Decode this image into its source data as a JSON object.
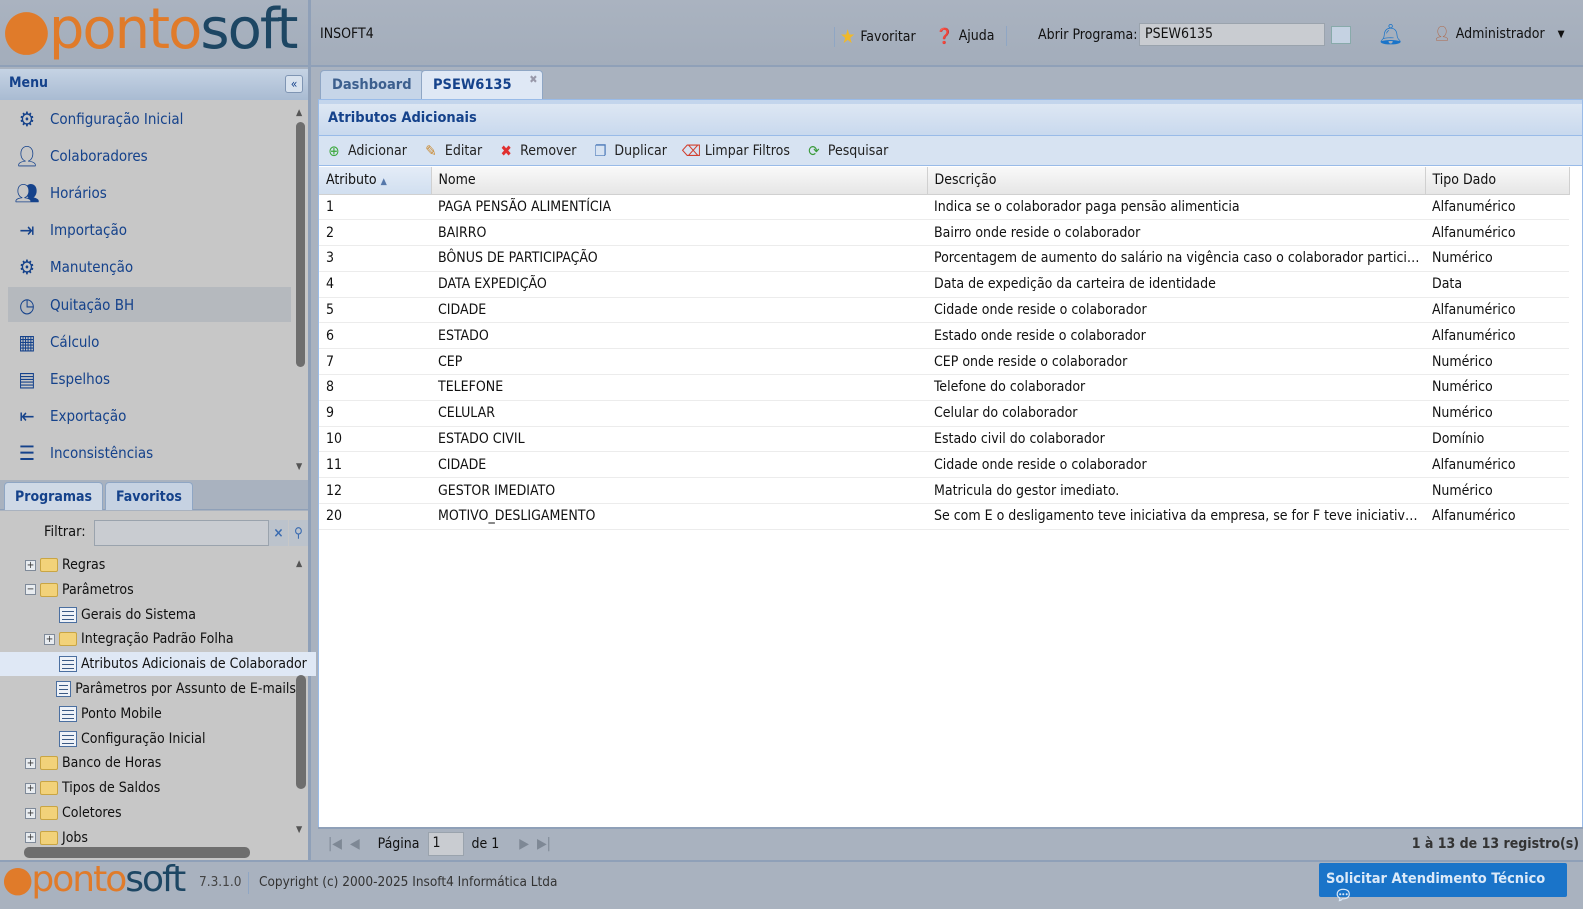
{
  "header": {
    "logo": "pontosoft",
    "company": "INSOFT4",
    "favoritar": "Favoritar",
    "ajuda": "Ajuda",
    "abrir_label": "Abrir Programa:",
    "abrir_value": "PSEW6135",
    "user": "Administrador"
  },
  "menu": {
    "title": "Menu",
    "items": [
      {
        "label": "Configuração Inicial",
        "icon": "gears-icon"
      },
      {
        "label": "Colaboradores",
        "icon": "user-icon"
      },
      {
        "label": "Horários",
        "icon": "user-clock-icon"
      },
      {
        "label": "Importação",
        "icon": "import-icon"
      },
      {
        "label": "Manutenção",
        "icon": "users-gear-icon"
      },
      {
        "label": "Quitação BH",
        "icon": "clock-icon"
      },
      {
        "label": "Cálculo",
        "icon": "calculator-icon"
      },
      {
        "label": "Espelhos",
        "icon": "id-card-icon"
      },
      {
        "label": "Exportação",
        "icon": "export-icon"
      },
      {
        "label": "Inconsistências",
        "icon": "list-icon"
      }
    ]
  },
  "panel_tabs": {
    "programas": "Programas",
    "favoritos": "Favoritos",
    "filter_label": "Filtrar:",
    "filter_value": ""
  },
  "tree": [
    {
      "label": "Regras",
      "type": "folder",
      "level": 0,
      "exp": "+"
    },
    {
      "label": "Parâmetros",
      "type": "folder",
      "level": 0,
      "exp": "-"
    },
    {
      "label": "Gerais do Sistema",
      "type": "doc",
      "level": 1
    },
    {
      "label": "Integração Padrão Folha",
      "type": "folder",
      "level": 1,
      "exp": "+"
    },
    {
      "label": "Atributos Adicionais de Colaborador",
      "type": "doc",
      "level": 1,
      "selected": true
    },
    {
      "label": "Parâmetros por Assunto de E-mails",
      "type": "doc",
      "level": 1
    },
    {
      "label": "Ponto Mobile",
      "type": "doc",
      "level": 1
    },
    {
      "label": "Configuração Inicial",
      "type": "doc",
      "level": 1
    },
    {
      "label": "Banco de Horas",
      "type": "folder",
      "level": 0,
      "exp": "+"
    },
    {
      "label": "Tipos de Saldos",
      "type": "folder",
      "level": 0,
      "exp": "+"
    },
    {
      "label": "Coletores",
      "type": "folder",
      "level": 0,
      "exp": "+"
    },
    {
      "label": "Jobs",
      "type": "folder",
      "level": 0,
      "exp": "+"
    }
  ],
  "tabs": [
    {
      "label": "Dashboard"
    },
    {
      "label": "PSEW6135",
      "active": true
    }
  ],
  "panel": {
    "title": "Atributos Adicionais",
    "toolbar": [
      "Adicionar",
      "Editar",
      "Remover",
      "Duplicar",
      "Limpar Filtros",
      "Pesquisar"
    ],
    "columns": [
      "Atributo",
      "Nome",
      "Descrição",
      "Tipo Dado"
    ],
    "rows": [
      [
        "1",
        "PAGA PENSÃO ALIMENTÍCIA",
        "Indica se o colaborador paga pensão alimenticia",
        "Alfanumérico"
      ],
      [
        "2",
        "BAIRRO",
        "Bairro onde reside o colaborador",
        "Alfanumérico"
      ],
      [
        "3",
        "BÔNUS DE PARTICIPAÇÃO",
        "Porcentagem de aumento do salário na vigência caso o colaborador participe ...",
        "Numérico"
      ],
      [
        "4",
        "DATA EXPEDIÇÃO",
        "Data de expedição da carteira de identidade",
        "Data"
      ],
      [
        "5",
        "CIDADE",
        "Cidade onde reside o colaborador",
        "Alfanumérico"
      ],
      [
        "6",
        "ESTADO",
        "Estado onde reside o colaborador",
        "Alfanumérico"
      ],
      [
        "7",
        "CEP",
        "CEP onde reside o colaborador",
        "Numérico"
      ],
      [
        "8",
        "TELEFONE",
        "Telefone do colaborador",
        "Numérico"
      ],
      [
        "9",
        "CELULAR",
        "Celular do colaborador",
        "Numérico"
      ],
      [
        "10",
        "ESTADO CIVIL",
        "Estado civil do colaborador",
        "Domínio"
      ],
      [
        "11",
        "CIDADE",
        "Cidade onde reside o colaborador",
        "Alfanumérico"
      ],
      [
        "12",
        "GESTOR IMEDIATO",
        "Matricula do gestor imediato.",
        "Numérico"
      ],
      [
        "20",
        "MOTIVO_DESLIGAMENTO",
        "Se com E o desligamento teve iniciativa da empresa, se for F teve iniciativa pe...",
        "Alfanumérico"
      ]
    ]
  },
  "pager": {
    "page_label": "Página",
    "page": "1",
    "of": "de 1",
    "summary": "1 à 13 de 13 registro(s)"
  },
  "footer": {
    "version": "7.3.1.0",
    "copyright": "Copyright (c) 2000-2025 Insoft4 Informática Ltda",
    "support": "Solicitar Atendimento Técnico"
  }
}
